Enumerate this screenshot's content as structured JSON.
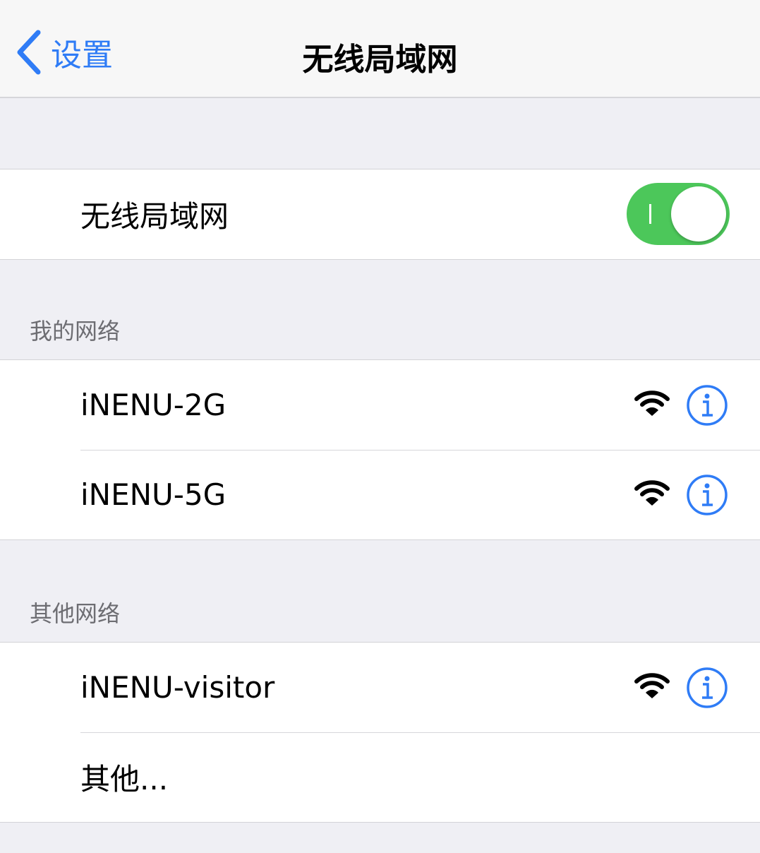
{
  "nav": {
    "back_label": "设置",
    "title": "无线局域网"
  },
  "wifi_toggle": {
    "label": "无线局域网",
    "on": true,
    "color": "#4cc75a"
  },
  "my_networks": {
    "header": "我的网络",
    "items": [
      {
        "name": "iNENU-2G",
        "icon": "wifi-icon"
      },
      {
        "name": "iNENU-5G",
        "icon": "wifi-icon"
      }
    ]
  },
  "other_networks": {
    "header": "其他网络",
    "items": [
      {
        "name": "iNENU-visitor",
        "icon": "wifi-icon"
      }
    ],
    "other_label": "其他..."
  },
  "colors": {
    "accent": "#2f7cf6",
    "toggle_on": "#4cc75a",
    "background": "#efeff4"
  }
}
